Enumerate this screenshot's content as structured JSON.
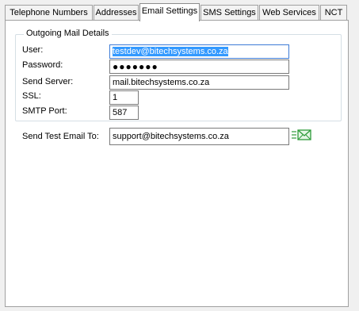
{
  "tabs": [
    {
      "label": "Telephone Numbers",
      "active": false
    },
    {
      "label": "Addresses",
      "active": false
    },
    {
      "label": "Email Settings",
      "active": true
    },
    {
      "label": "SMS Settings",
      "active": false
    },
    {
      "label": "Web Services",
      "active": false
    },
    {
      "label": "NCT",
      "active": false
    }
  ],
  "outgoing": {
    "title": "Outgoing Mail Details",
    "user_label": "User:",
    "user_value": "testdev@bitechsystems.co.za",
    "password_label": "Password:",
    "password_value": "●●●●●●●",
    "server_label": "Send Server:",
    "server_value": "mail.bitechsystems.co.za",
    "ssl_label": "SSL:",
    "ssl_value": "1",
    "port_label": "SMTP Port:",
    "port_value": "587"
  },
  "test_email": {
    "label": "Send Test Email To:",
    "value": "support@bitechsystems.co.za",
    "send_icon": "send-email-icon"
  },
  "colors": {
    "selection": "#3399ff",
    "icon_green": "#2e9b3a"
  }
}
